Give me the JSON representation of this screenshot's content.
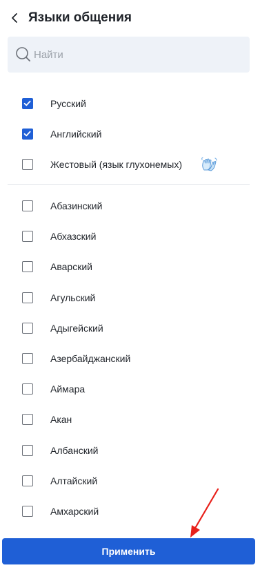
{
  "header": {
    "title": "Языки общения",
    "back_icon": "chevron-left-icon"
  },
  "search": {
    "placeholder": "Найти",
    "value": "",
    "icon": "search-icon"
  },
  "selected_languages": [
    {
      "label": "Русский",
      "checked": true
    },
    {
      "label": "Английский",
      "checked": true
    },
    {
      "label": "Жестовый (язык глухонемых)",
      "checked": false,
      "icon": "waving-hands-icon"
    }
  ],
  "languages": [
    {
      "label": "Абазинский",
      "checked": false
    },
    {
      "label": "Абхазский",
      "checked": false
    },
    {
      "label": "Аварский",
      "checked": false
    },
    {
      "label": "Агульский",
      "checked": false
    },
    {
      "label": "Адыгейский",
      "checked": false
    },
    {
      "label": "Азербайджанский",
      "checked": false
    },
    {
      "label": "Аймара",
      "checked": false
    },
    {
      "label": "Акан",
      "checked": false
    },
    {
      "label": "Албанский",
      "checked": false
    },
    {
      "label": "Алтайский",
      "checked": false
    },
    {
      "label": "Амхарский",
      "checked": false
    }
  ],
  "apply_button": {
    "label": "Применить"
  },
  "colors": {
    "accent": "#1f5fd6",
    "annotation_arrow": "#e8201a",
    "search_bg": "#eef2f8"
  }
}
